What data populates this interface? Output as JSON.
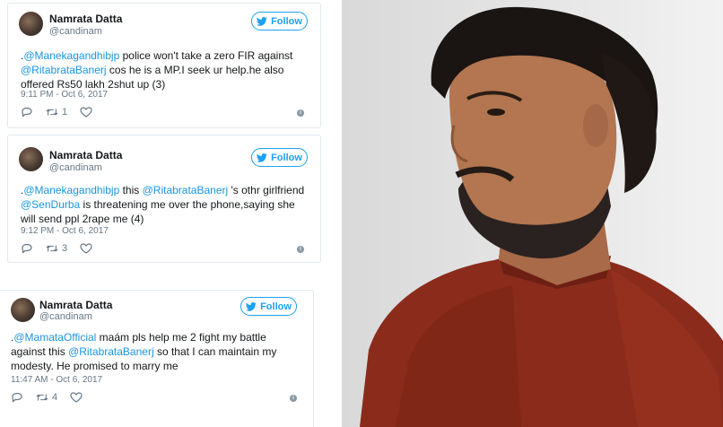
{
  "tweets": [
    {
      "name": "Namrata Datta",
      "handle": "@candinam",
      "follow_label": "Follow",
      "segments": [
        {
          "text": ".",
          "mention": false
        },
        {
          "text": "@Manekagandhibjp",
          "mention": true
        },
        {
          "text": " police won't take a zero FIR against ",
          "mention": false
        },
        {
          "text": "@RitabrataBanerj",
          "mention": true
        },
        {
          "text": " cos he is a MP.I seek ur help.he also offered Rs50 lakh 2shut up (3)",
          "mention": false
        }
      ],
      "time": "9:11 PM - Oct 6, 2017",
      "retweets": "1",
      "likes": ""
    },
    {
      "name": "Namrata Datta",
      "handle": "@candinam",
      "follow_label": "Follow",
      "segments": [
        {
          "text": ".",
          "mention": false
        },
        {
          "text": "@Manekagandhibjp",
          "mention": true
        },
        {
          "text": " this ",
          "mention": false
        },
        {
          "text": "@RitabrataBanerj",
          "mention": true
        },
        {
          "text": " 's othr girlfriend ",
          "mention": false
        },
        {
          "text": "@SenDurba",
          "mention": true
        },
        {
          "text": " is threatening me over the phone,saying she will send ppl 2rape me (4)",
          "mention": false
        }
      ],
      "time": "9:12 PM - Oct 6, 2017",
      "retweets": "3",
      "likes": ""
    },
    {
      "name": "Namrata Datta",
      "handle": "@candinam",
      "follow_label": "Follow",
      "segments": [
        {
          "text": ".",
          "mention": false
        },
        {
          "text": "@MamataOfficial",
          "mention": true
        },
        {
          "text": " maám pls help me 2 fight my battle against this ",
          "mention": false
        },
        {
          "text": "@RitabrataBanerj",
          "mention": true
        },
        {
          "text": " so that I can maintain my modesty. He promised to marry me",
          "mention": false
        }
      ],
      "time": "11:47 AM - Oct 6, 2017",
      "retweets": "4",
      "likes": ""
    }
  ],
  "icons": {
    "reply": "reply-icon",
    "retweet": "retweet-icon",
    "like": "heart-icon",
    "info": "info-icon",
    "bird": "twitter-bird-icon"
  },
  "colors": {
    "accent": "#1da1f2",
    "mention": "#1b95e0",
    "meta": "#657786"
  }
}
